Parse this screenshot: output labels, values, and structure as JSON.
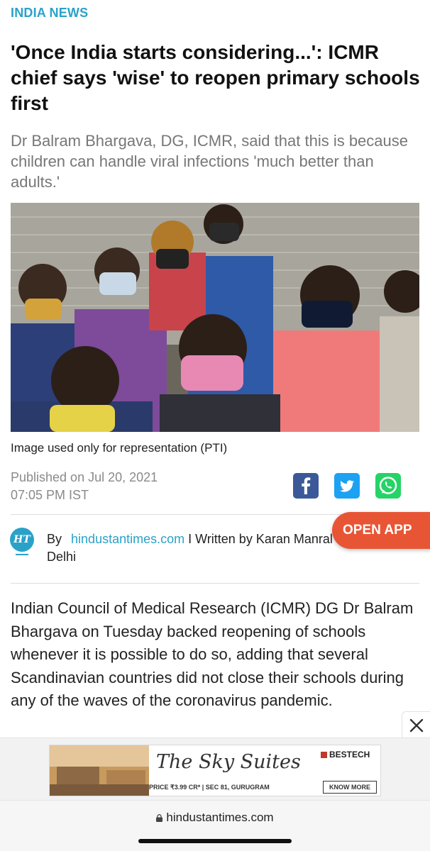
{
  "article": {
    "category": "INDIA NEWS",
    "headline": "'Once India starts considering...': ICMR chief says 'wise' to reopen primary schools first",
    "summary": "Dr Balram Bhargava, DG, ICMR, said that this is because children can handle viral infections 'much better than adults.'",
    "image_caption": "Image used only for representation (PTI)",
    "published_date": "Published on Jul 20, 2021",
    "published_time": "07:05 PM IST",
    "byline_prefix": "By",
    "byline_source": "hindustantimes.com",
    "byline_author": "I Written by Karan Manral",
    "byline_city": "Delhi",
    "body": "Indian Council of Medical Research (ICMR) DG Dr Balram Bhargava on Tuesday backed reopening of schools whenever it is possible to do so, adding that several Scandinavian countries did not close their schools during any of the waves of the coronavirus pandemic."
  },
  "share": {
    "icons": [
      "facebook-icon",
      "twitter-icon",
      "whatsapp-icon"
    ],
    "colors": {
      "facebook": "#3b5998",
      "twitter": "#1da1f2",
      "whatsapp": "#25d366"
    }
  },
  "logo_text": "HT",
  "open_app_label": "OPEN APP",
  "ad": {
    "title": "The Sky Suites",
    "brand": "BESTECH",
    "price": "PRICE ₹3.99 CR* | SEC 81, GURUGRAM",
    "cta": "KNOW MORE"
  },
  "browser": {
    "url": "hindustantimes.com"
  },
  "colors": {
    "accent": "#2aa2c8",
    "open_app": "#e85535"
  }
}
